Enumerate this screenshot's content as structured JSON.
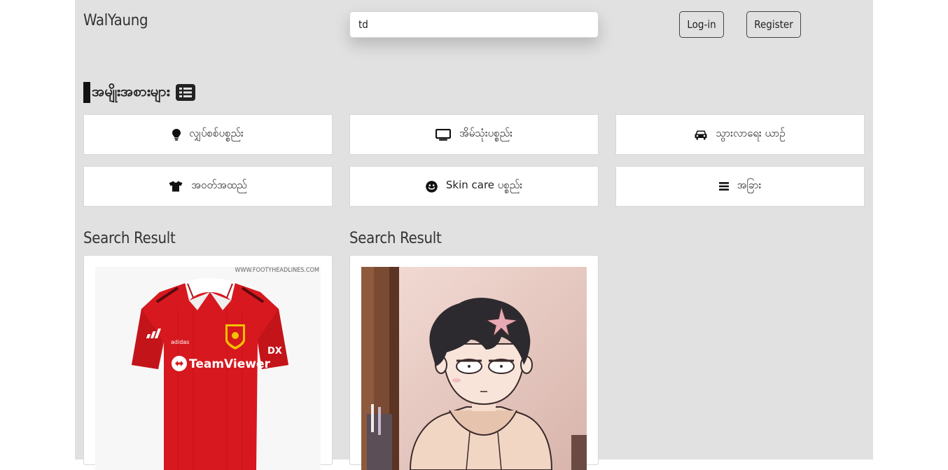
{
  "header": {
    "brand": "WalYaung",
    "search_value": "td",
    "login_label": "Log-in",
    "register_label": "Register"
  },
  "categories": {
    "title": "အမျိုးအစားများ",
    "icon": "list-icon",
    "items": [
      {
        "label": "လျှပ်စစ်ပစ္စည်း",
        "icon": "lightbulb-icon"
      },
      {
        "label": "အိမ်သုံးပစ္စည်း",
        "icon": "tv-icon"
      },
      {
        "label": "သွားလာရေး ယာဥ်",
        "icon": "car-icon"
      },
      {
        "label": "အဝတ်အထည်",
        "icon": "tshirt-icon"
      },
      {
        "label": "Skin care ပစ္စည်း",
        "icon": "smile-icon"
      },
      {
        "label": "အခြား",
        "icon": "bars-icon"
      }
    ]
  },
  "results": [
    {
      "title": "Search Result",
      "image": "red-football-jersey",
      "watermark": "WWW.FOOTYHEADLINES.COM",
      "jersey_text": "TeamViewer",
      "jersey_brand": "adidas"
    },
    {
      "title": "Search Result",
      "image": "anime-boy-hoodie"
    }
  ],
  "colors": {
    "background": "#e1e1e1",
    "card": "#ffffff",
    "jersey_red": "#d7181f"
  }
}
